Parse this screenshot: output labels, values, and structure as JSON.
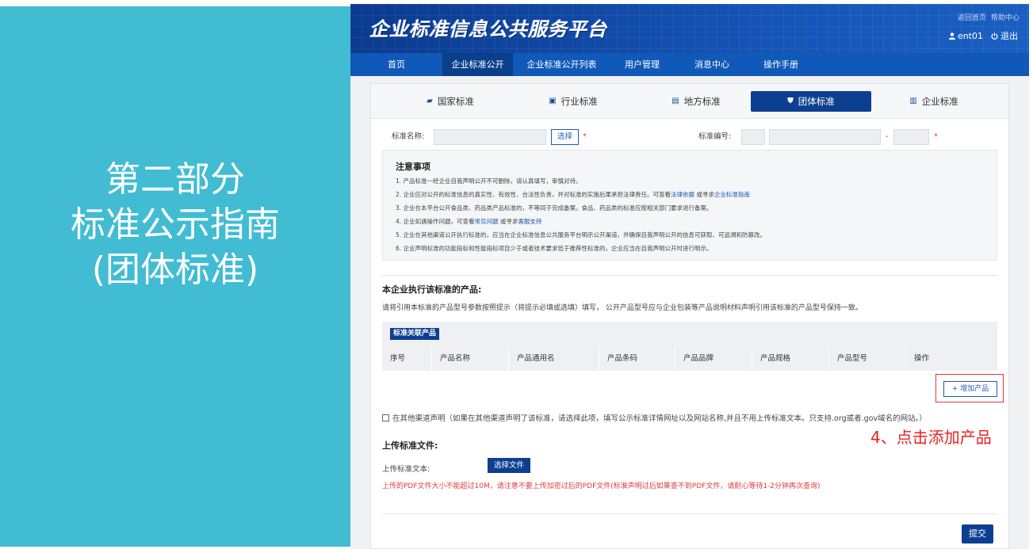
{
  "slide": {
    "title_lines": [
      "第二部分",
      "标准公示指南",
      "(团体标准)"
    ]
  },
  "header": {
    "brand": "企业标准信息公共服务平台",
    "top_links": [
      "返回首页",
      "帮助中心"
    ],
    "user": "ent01",
    "logout": "退出"
  },
  "nav": {
    "items": [
      "首页",
      "企业标准公开",
      "企业标准公开列表",
      "用户管理",
      "消息中心",
      "操作手册"
    ],
    "active_index": 1
  },
  "std_tabs": {
    "items": [
      {
        "label": "国家标准",
        "icon": "book-icon"
      },
      {
        "label": "行业标准",
        "icon": "briefcase-icon"
      },
      {
        "label": "地方标准",
        "icon": "document-icon"
      },
      {
        "label": "团体标准",
        "icon": "shield-icon"
      },
      {
        "label": "企业标准",
        "icon": "bank-icon"
      }
    ],
    "active_index": 3
  },
  "form": {
    "name_label": "标准名称:",
    "select_button": "选择",
    "required_mark": "*",
    "code_label": "标准编号:",
    "dash": "-"
  },
  "notice": {
    "title": "注意事项",
    "lines": [
      {
        "text": "1. 产品标准一经企业自我声明公开不可删除，请认真填写，审慎对待。"
      },
      {
        "text": "2. 企业应对公开的标准信息的真实性、有效性、合法性负责，并对标准的实施后果承担法律责任。可查看",
        "link1": "法律依据",
        "mid": " 或寻求",
        "link2": "企业标准指南"
      },
      {
        "text": "3. 企业在本平台公开食品类、药品类产品标准的，不等同于完成备案。食品、药品类的标准应按相关部门要求进行备案。"
      },
      {
        "text": "4. 企业如遇操作问题，可查看",
        "link1": "常见问题",
        "mid": " 或寻求",
        "link2": "客服支持"
      },
      {
        "text": "5. 企业在其他渠道公开执行标准的，应当在企业标准信息公共服务平台明示公开渠道，并确保自我声明公开的信息可获取、可追溯和防篡改。"
      },
      {
        "text": "6. 企业声明标准的功能指标和性能指标项目少于或者技术要求低于推荐性标准的，企业应当在自我声明公开时进行明示。"
      }
    ]
  },
  "products": {
    "title": "本企业执行该标准的产品:",
    "desc": "请将引用本标准的产品型号参数按照提示（将提示必填或选填）填写， 公开产品型号应与企业包装等产品说明材料声明引用该标准的产品型号保持一致。",
    "badge": "标准关联产品",
    "columns": [
      "序号",
      "产品名称",
      "产品通用名",
      "产品条码",
      "产品品牌",
      "产品规格",
      "产品型号",
      "操作"
    ],
    "add_button": "增加产品"
  },
  "other_channel": {
    "label": "在其他渠道声明（如果在其他渠道声明了该标准，请选择此项，填写公示标准详情网址以及网站名称,并且不用上传标准文本。只支持.org或者.gov域名的网站。）"
  },
  "annotation": "4、点击添加产品",
  "upload": {
    "title": "上传标准文件:",
    "label": "上传标准文本:",
    "button": "选择文件",
    "warning": "上传的PDF文件大小不能超过10M，请注意不要上传加密过后的PDF文件(标准声明过后如果查不到PDF文件，请耐心等待1-2分钟再次查询)"
  },
  "submit": "提交",
  "colors": {
    "slide_teal": "#41bcd3",
    "brand_blue": "#0d3f91",
    "nav_blue": "#1059b8",
    "annotation_red": "#e8201f"
  }
}
